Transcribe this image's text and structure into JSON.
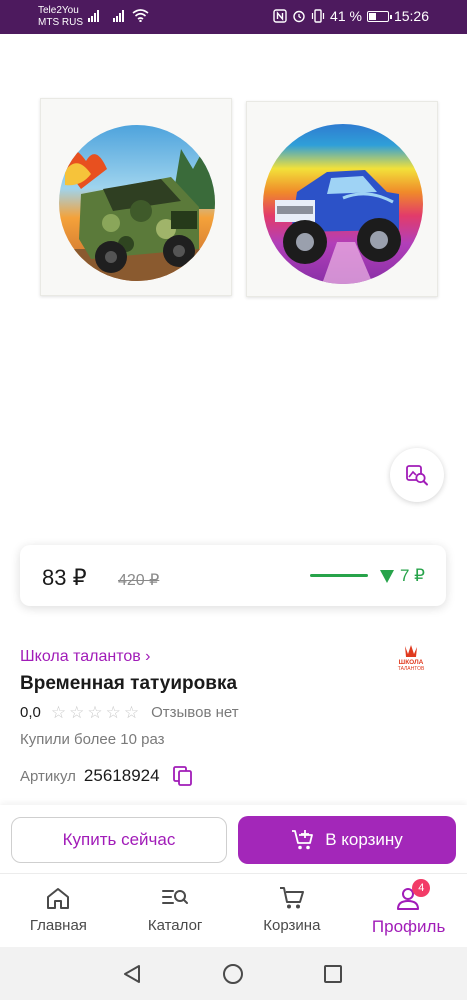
{
  "status_bar": {
    "carrier_1": "Tele2You",
    "carrier_2": "MTS RUS",
    "battery": "41 %",
    "battery_level": 0.41,
    "time": "15:26"
  },
  "product": {
    "price_current": "83 ₽",
    "price_old": "420 ₽",
    "price_drop": "7 ₽",
    "brand": "Школа талантов ›",
    "brand_logo_text": "ШКОЛА ТАЛАНТОВ",
    "title": "Временная татуировка",
    "rating": "0,0",
    "stars_filled": 0,
    "stars_total": 5,
    "reviews": "Отзывов нет",
    "bought": "Купили более 10 раз",
    "article_label": "Артикул",
    "article_number": "25618924"
  },
  "actions": {
    "buy_now": "Купить сейчас",
    "add_to_cart": "В корзину"
  },
  "bottom_nav": {
    "items": [
      {
        "label": "Главная",
        "icon": "home-icon"
      },
      {
        "label": "Каталог",
        "icon": "catalog-search-icon"
      },
      {
        "label": "Корзина",
        "icon": "cart-icon"
      },
      {
        "label": "Профиль",
        "icon": "profile-icon",
        "badge": "4",
        "active": true
      }
    ]
  },
  "colors": {
    "accent": "#a11cb8",
    "button": "#a327b9",
    "status_bar": "#4d1a5e",
    "price_drop": "#27a34a",
    "badge": "#f23b67"
  }
}
